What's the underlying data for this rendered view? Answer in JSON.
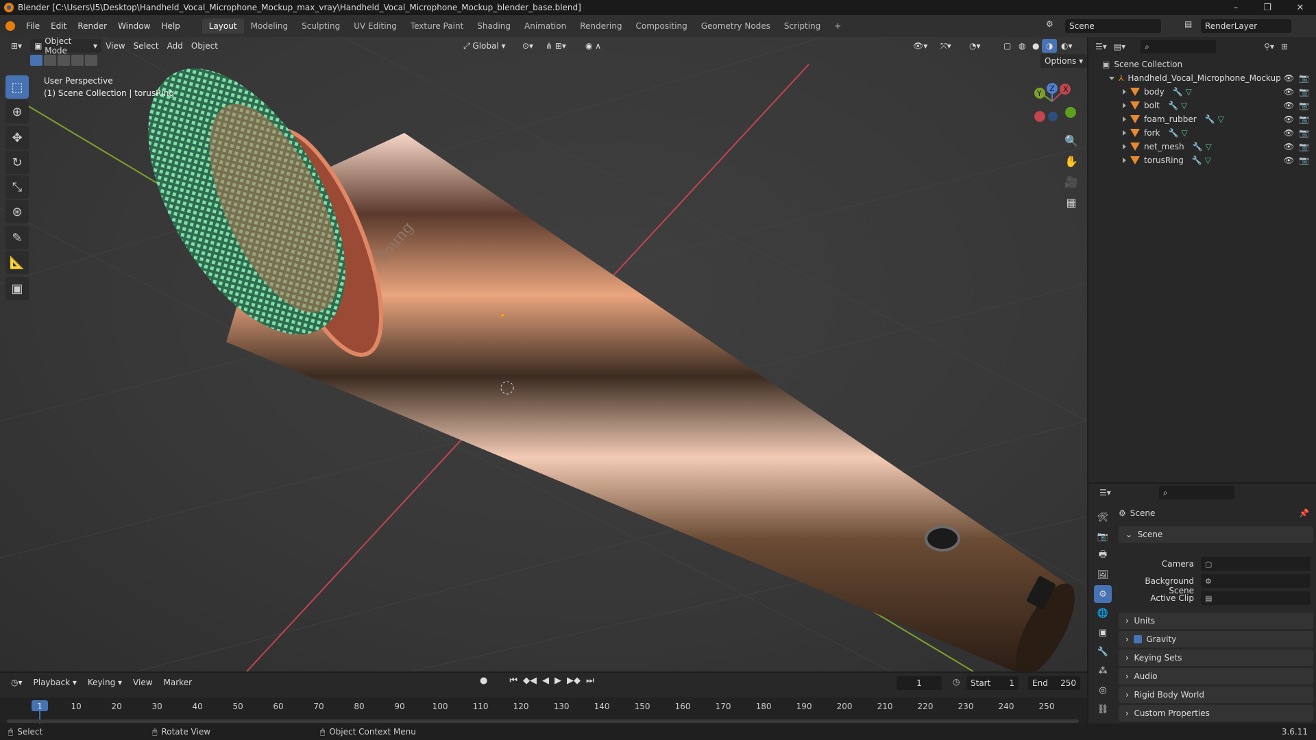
{
  "window": {
    "title": "Blender [C:\\Users\\I5\\Desktop\\Handheld_Vocal_Microphone_Mockup_max_vray\\Handheld_Vocal_Microphone_Mockup_blender_base.blend]",
    "minimize": "–",
    "maximize": "❐",
    "close": "✕"
  },
  "menu": {
    "items": [
      "File",
      "Edit",
      "Render",
      "Window",
      "Help"
    ],
    "workspaces": [
      "Layout",
      "Modeling",
      "Sculpting",
      "UV Editing",
      "Texture Paint",
      "Shading",
      "Animation",
      "Rendering",
      "Compositing",
      "Geometry Nodes",
      "Scripting"
    ],
    "add_tab": "+",
    "scene": "Scene",
    "render_layer": "RenderLayer"
  },
  "viewport": {
    "mode": "Object Mode",
    "menus": [
      "View",
      "Select",
      "Add",
      "Object"
    ],
    "orientation": "Global",
    "options": "Options",
    "perspective": "User Perspective",
    "collection_info": "(1) Scene Collection | torusRing",
    "gizmo": {
      "x": "X",
      "y": "Y",
      "z": "Z"
    },
    "engraving": "Young"
  },
  "outliner": {
    "root": "Scene Collection",
    "collection": "Handheld_Vocal_Microphone_Mockup",
    "objects": [
      "body",
      "bolt",
      "foam_rubber",
      "fork",
      "net_mesh",
      "torusRing"
    ]
  },
  "properties": {
    "context": "Scene",
    "section": "Scene",
    "camera_label": "Camera",
    "bg_scene_label": "Background Scene",
    "active_clip_label": "Active Clip",
    "collapsed": [
      "Units",
      "Gravity",
      "Keying Sets",
      "Audio",
      "Rigid Body World",
      "Custom Properties"
    ]
  },
  "timeline": {
    "menus": [
      "Playback",
      "Keying",
      "View",
      "Marker"
    ],
    "current_frame": "1",
    "start_label": "Start",
    "start": "1",
    "end_label": "End",
    "end": "250",
    "ticks": [
      "1",
      "10",
      "20",
      "30",
      "40",
      "50",
      "60",
      "70",
      "80",
      "90",
      "100",
      "110",
      "120",
      "130",
      "140",
      "150",
      "160",
      "170",
      "180",
      "190",
      "200",
      "210",
      "220",
      "230",
      "240",
      "250"
    ]
  },
  "status": {
    "select": "Select",
    "rotate": "Rotate View",
    "context_menu": "Object Context Menu",
    "version": "3.6.11"
  },
  "colors": {
    "accent": "#4772b3",
    "object_icon": "#e78a32",
    "grid_x": "#c2454f",
    "grid_y": "#7ea12c",
    "mesh_green": "#6fcf9b"
  }
}
